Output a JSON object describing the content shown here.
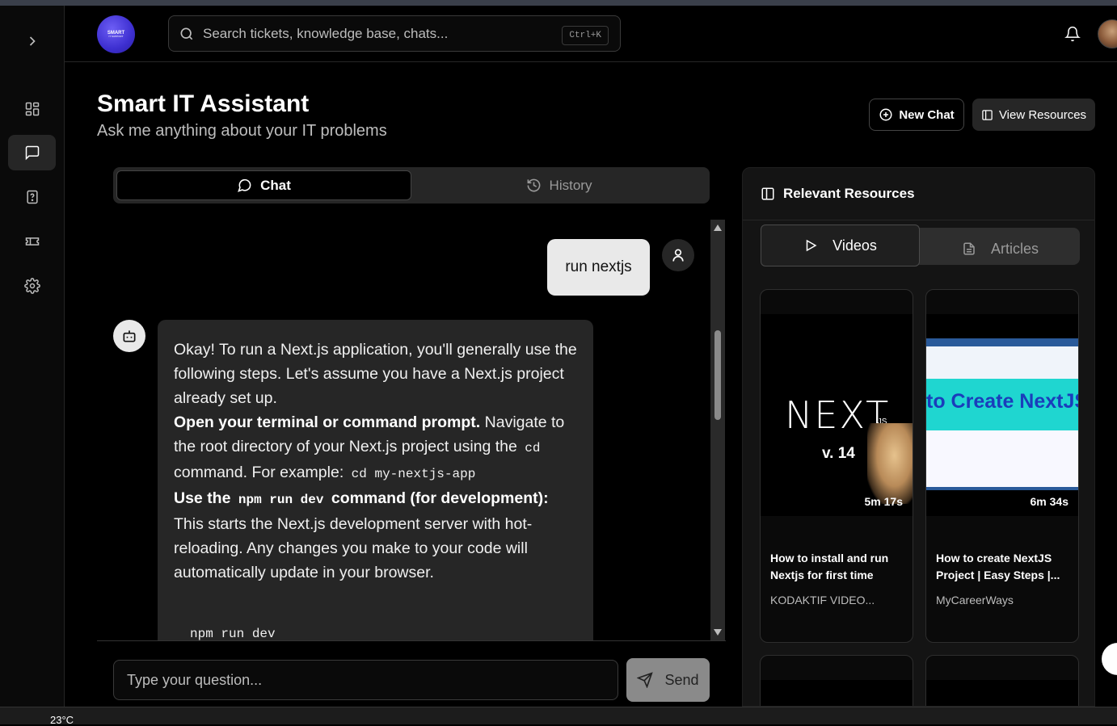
{
  "app": {
    "logo_line1": "SMART",
    "logo_line2": "IT SUPPORT"
  },
  "search": {
    "placeholder": "Search tickets, knowledge base, chats...",
    "shortcut": "Ctrl+K"
  },
  "page": {
    "title": "Smart IT Assistant",
    "subtitle": "Ask me anything about your IT problems"
  },
  "actions": {
    "new_chat": "New Chat",
    "view_resources": "View Resources"
  },
  "tabs": {
    "chat": "Chat",
    "history": "History"
  },
  "messages": {
    "user": "run nextjs",
    "bot": {
      "intro": "Okay! To run a Next.js application, you'll generally use the following steps. Let's assume you have a Next.js project already set up.",
      "step1_bold": "Open your terminal or command prompt.",
      "step1_text_a": " Navigate to the root directory of your Next.js project using the ",
      "step1_code_a": "cd",
      "step1_text_b": " command. For example: ",
      "step1_code_b": "cd my-nextjs-app",
      "step2_bold_a": "Use the ",
      "step2_code": "npm run dev",
      "step2_bold_b": " command (for development):",
      "step2_text": " This starts the Next.js development server with hot-reloading. Any changes you make to your code will automatically update in your browser.",
      "codeblock": "npm run dev"
    }
  },
  "composer": {
    "placeholder": "Type your question...",
    "send": "Send"
  },
  "resources": {
    "title": "Relevant Resources",
    "tabs": {
      "videos": "Videos",
      "articles": "Articles"
    },
    "videos": [
      {
        "title": "How to install and run Nextjs for first time",
        "channel": "KODAKTIF VIDEO...",
        "duration": "5m 17s",
        "thumb_text": "NEXT",
        "thumb_sub": ".JS",
        "thumb_version": "v. 14"
      },
      {
        "title": "How to create NextJS Project | Easy Steps |...",
        "channel": "MyCareerWays",
        "duration": "6m 34s",
        "thumb_text": "to Create NextJS"
      }
    ]
  },
  "taskbar": {
    "temperature": "23°C"
  },
  "colors": {
    "bg": "#000000",
    "surface": "#262626",
    "accent_logo": "#4b3de0"
  }
}
